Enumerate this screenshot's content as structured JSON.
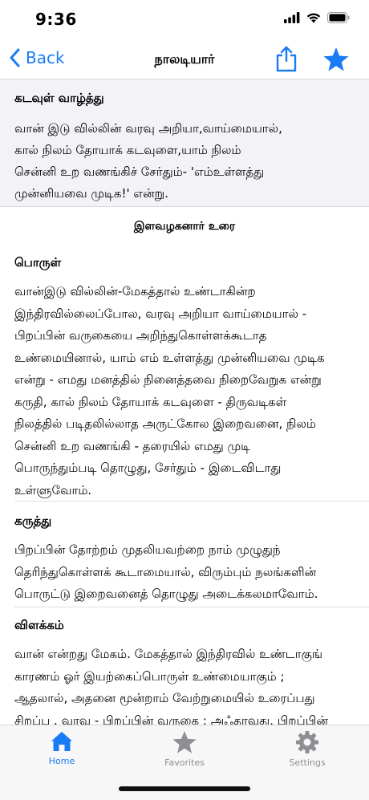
{
  "status": {
    "time": "9:36"
  },
  "nav": {
    "back_label": "Back",
    "title": "நாலடியார்"
  },
  "header": {
    "title": "கடவுள் வாழ்த்து",
    "verse_lines": [
      "வான் இடு வில்லின் வரவு அறியா,வாய்மையால்,",
      "கால் நிலம் தோயாக் கடவுளை,யாம் நிலம்",
      "சென்னி உற வணங்கிச் சேர்தும்- 'எம்உள்ளத்து",
      "முன்னியவை முடிக!' என்று."
    ]
  },
  "commentary": {
    "title": "இளவழகனார் உரை",
    "sections": [
      {
        "title": "பொருள்",
        "lines": [
          "வான்இடு வில்லின்-மேகத்தால் உண்டாகின்ற",
          "இந்திரவில்லைப்போல, வரவு அறியா வாய்மையால் -",
          "பிறப்பின் வருகையை அறிந்துகொள்ளக்கூடாத",
          "உண்மையினால், யாம் எம் உள்ளத்து முன்னியவை முடிக",
          "என்று - எமது மனத்தில் நினைத்தவை நிறைவேறுக என்று",
          "கருதி, கால் நிலம் தோயாக் கடவுளை - திருவடிகள்",
          "நிலத்தில் படிதலில்லாத அருட்கோல இறைவனை, நிலம்",
          "சென்னி உற வணங்கி - தரையில் எமது முடி",
          "பொருந்தும்படி தொழுது, சேர்தும் - இடைவிடாது",
          "உள்ளுவோம்."
        ]
      },
      {
        "title": "கருத்து",
        "lines": [
          "பிறப்பின் தோற்றம் முதலியவற்றை நாம் முழுதுந்",
          "தெரிந்துகொள்ளக் கூடாமையால், விரும்பும் நலங்களின்",
          "பொருட்டு இறைவனைத் தொழுது அடைக்கலமாவோம்."
        ]
      },
      {
        "title": "விளக்கம்",
        "lines": [
          "வான் என்றது மேகம். மேகத்தால் இந்திரவில் உண்டாகுங்",
          "காரணம் ஓர் இயற்கைப்பொருள் உண்மையாகும் ;",
          "ஆதலால், அதனை மூன்றாம் வேற்றுமையில் உரைப்பது",
          "சிறப்பு . வரவு - பிறப்பின் வருகை ; அஃதாவது, பிறப்பின்"
        ]
      }
    ]
  },
  "tabs": [
    {
      "label": "Home",
      "icon": "house-icon",
      "active": true
    },
    {
      "label": "Favorites",
      "icon": "star-icon",
      "active": false
    },
    {
      "label": "Settings",
      "icon": "gear-icon",
      "active": false
    }
  ],
  "colors": {
    "accent": "#1a7cf5",
    "inactive": "#8e8e93",
    "header_bg": "#f2f2f7"
  }
}
